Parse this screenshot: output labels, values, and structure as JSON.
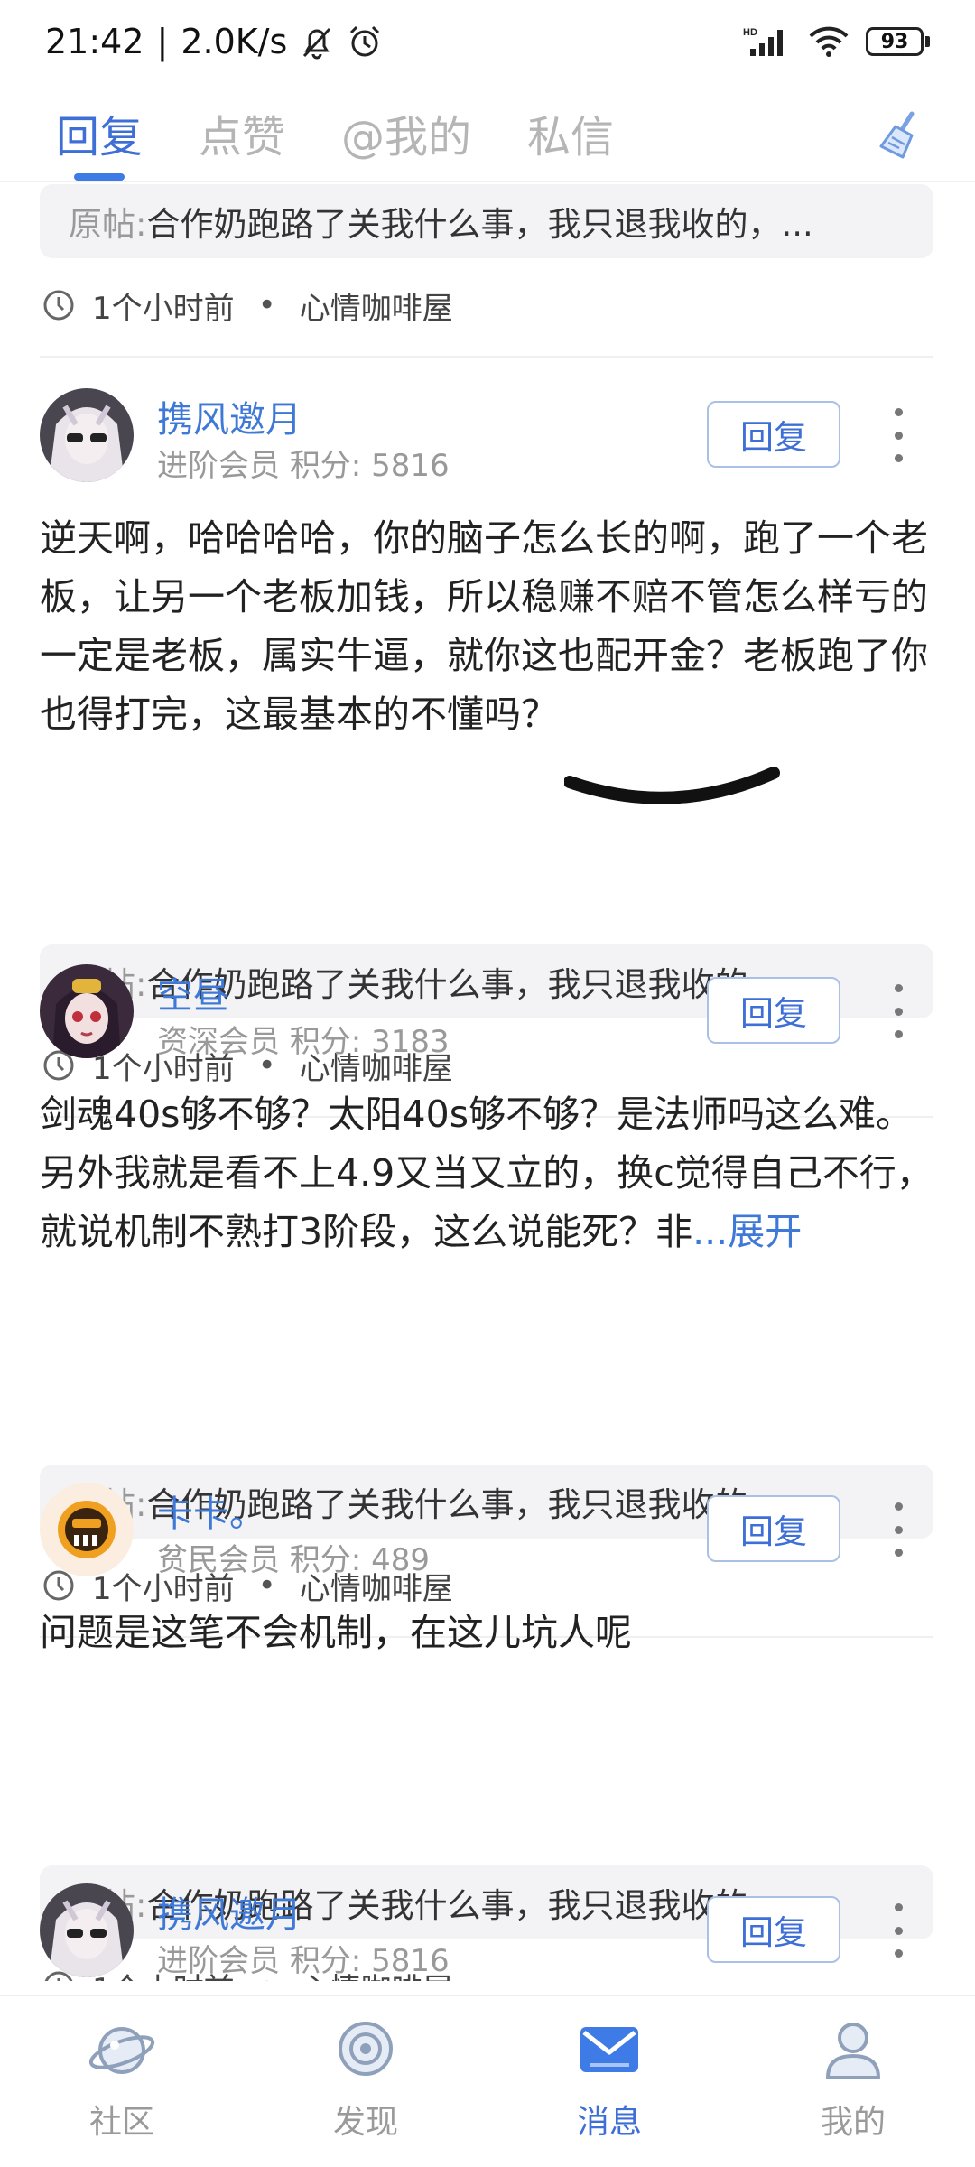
{
  "status": {
    "time": "21:42",
    "speed": "2.0K/s",
    "network": "HD",
    "battery": "93"
  },
  "tabs": [
    {
      "label": "回复",
      "active": true
    },
    {
      "label": "点赞",
      "active": false
    },
    {
      "label": "@我的",
      "active": false
    },
    {
      "label": "私信",
      "active": false
    }
  ],
  "top_partial": {
    "orig_label": "原帖:",
    "orig_text": "合作奶跑路了关我什么事，我只退我收的，...",
    "time": "1个小时前",
    "forum": "心情咖啡屋"
  },
  "items": [
    {
      "name": "携风邀月",
      "level": "进阶会员",
      "points": "积分: 5816",
      "reply_label": "回复",
      "content": "逆天啊，哈哈哈哈，你的脑子怎么长的啊，跑了一个老板，让另一个老板加钱，所以稳赚不赔不管怎么样亏的一定是老板，属实牛逼，就你这也配开金？老板跑了你也得打完，这最基本的不懂吗？",
      "orig_label": "原帖:",
      "orig_text": "合作奶跑路了关我什么事，我只退我收的，...",
      "time": "1个小时前",
      "forum": "心情咖啡屋"
    },
    {
      "name": "空昼",
      "level": "资深会员",
      "points": "积分: 3183",
      "reply_label": "回复",
      "content": "剑魂40s够不够？太阳40s够不够？是法师吗这么难。另外我就是看不上4.9又当又立的，换c觉得自己不行，就说机制不熟打3阶段，这么说能死？非",
      "expand": "...展开",
      "orig_label": "原帖:",
      "orig_text": "合作奶跑路了关我什么事，我只退我收的，...",
      "time": "1个小时前",
      "forum": "心情咖啡屋"
    },
    {
      "name": "卡卡。",
      "level": "贫民会员",
      "points": "积分: 489",
      "reply_label": "回复",
      "content": "问题是这笔不会机制，在这儿坑人呢",
      "orig_label": "原帖:",
      "orig_text": "合作奶跑路了关我什么事，我只退我收的，...",
      "time": "1个小时前",
      "forum": "心情咖啡屋"
    },
    {
      "name": "携风邀月",
      "level": "进阶会员",
      "points": "积分: 5816",
      "reply_label": "回复"
    }
  ],
  "bottom_nav": [
    {
      "label": "社区",
      "icon": "planet-icon",
      "active": false
    },
    {
      "label": "发现",
      "icon": "target-icon",
      "active": false
    },
    {
      "label": "消息",
      "icon": "mail-icon",
      "active": true
    },
    {
      "label": "我的",
      "icon": "user-icon",
      "active": false
    }
  ],
  "colors": {
    "accent": "#3e6fd6",
    "name": "#3f79d8",
    "muted": "#999999",
    "card_bg": "#f3f3f5"
  }
}
